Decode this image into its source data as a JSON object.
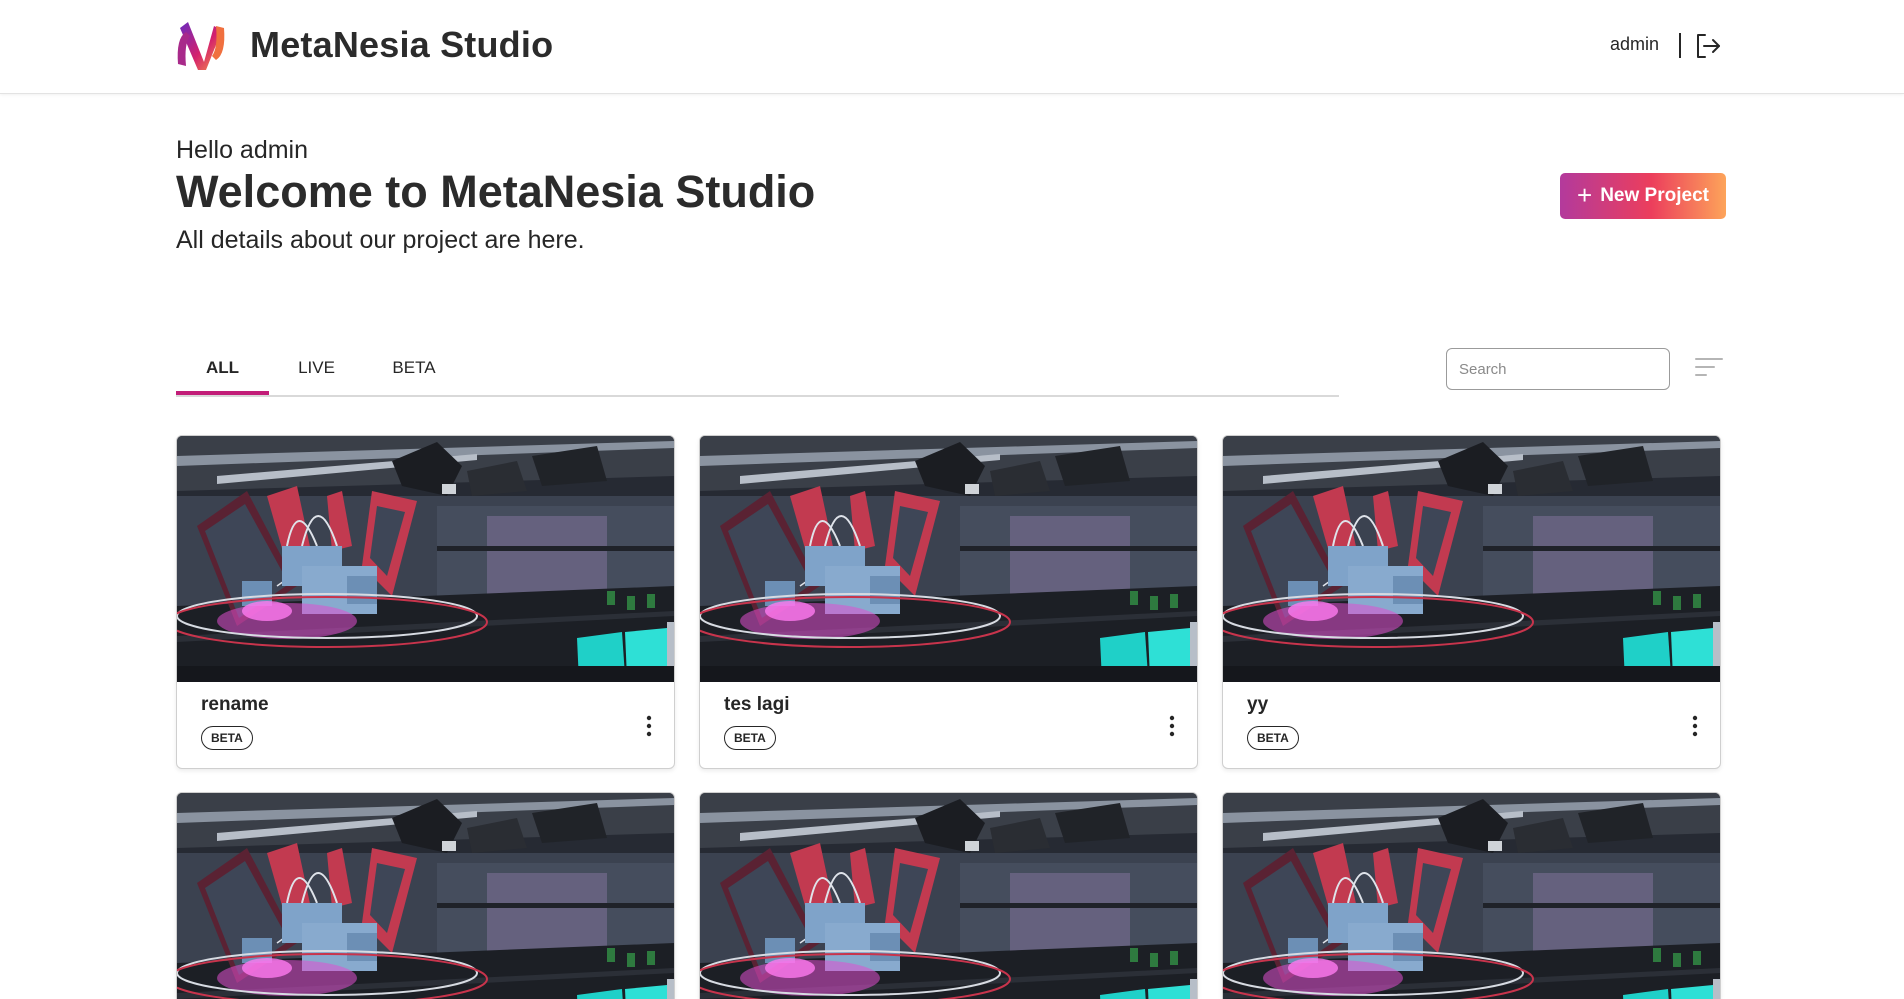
{
  "header": {
    "app_name": "MetaNesia Studio",
    "user_name": "admin",
    "icons": {
      "logo": "metanesia-logo",
      "logout": "logout-icon"
    },
    "colors": {
      "logo_gradient": [
        "#6a2bbf",
        "#d4206d",
        "#f79a43"
      ]
    }
  },
  "welcome": {
    "greeting": "Hello admin",
    "title": "Welcome to MetaNesia Studio",
    "subtitle": "All details about our project are here.",
    "new_project_label": "New Project"
  },
  "tabs": [
    {
      "label": "ALL",
      "active": true
    },
    {
      "label": "LIVE",
      "active": false
    },
    {
      "label": "BETA",
      "active": false
    }
  ],
  "search": {
    "placeholder": "Search",
    "value": ""
  },
  "projects": [
    {
      "name": "rename",
      "status": "BETA"
    },
    {
      "name": "tes lagi",
      "status": "BETA"
    },
    {
      "name": "yy",
      "status": "BETA"
    }
  ],
  "colors": {
    "accent": "#c21d78",
    "button_gradient": [
      "#b33a9c",
      "#ec3e5c",
      "#fda45a"
    ],
    "text": "#262626"
  }
}
